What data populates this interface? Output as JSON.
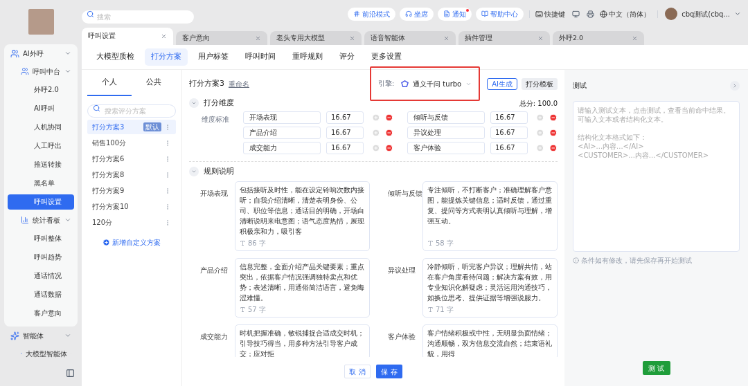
{
  "sidebar": {
    "nav": [
      {
        "label": "AI外呼",
        "expanded": true,
        "children": [
          {
            "label": "呼叫中台",
            "expanded": true,
            "children": [
              {
                "label": "外呼2.0",
                "selected": false
              },
              {
                "label": "AI呼叫",
                "selected": false
              },
              {
                "label": "人机协同",
                "selected": false
              },
              {
                "label": "人工呼出",
                "selected": false
              },
              {
                "label": "推送转接",
                "selected": false
              },
              {
                "label": "黑名单",
                "selected": false
              },
              {
                "label": "呼叫设置",
                "selected": true
              }
            ]
          },
          {
            "label": "统计看板",
            "expanded": true,
            "children": [
              {
                "label": "呼叫整体",
                "selected": false
              },
              {
                "label": "呼叫趋势",
                "selected": false
              },
              {
                "label": "通话情况",
                "selected": false
              },
              {
                "label": "通话数据",
                "selected": false
              },
              {
                "label": "客户意向",
                "selected": false
              }
            ]
          }
        ]
      },
      {
        "label": "智能体",
        "expanded": true,
        "children": [
          {
            "label": "大模型智能体",
            "expanded": false
          }
        ]
      }
    ]
  },
  "topbar": {
    "search": {
      "placeholder": "搜索"
    },
    "buttons": [
      {
        "label": "前沿模式",
        "badge": false
      },
      {
        "label": "坐席",
        "badge": false
      },
      {
        "label": "通知",
        "badge": true
      },
      {
        "label": "帮助中心",
        "badge": false
      }
    ],
    "shortcut": "快捷键",
    "language": "中文（简体）",
    "user": "cbq测试(cbq..."
  },
  "page_tabs": [
    {
      "label": "呼叫设置",
      "selected": true
    },
    {
      "label": "客户意向",
      "selected": false
    },
    {
      "label": "老头专用大模型",
      "selected": false
    },
    {
      "label": "语音智能体",
      "selected": false
    },
    {
      "label": "插件管理",
      "selected": false
    },
    {
      "label": "外呼2.0",
      "selected": false
    }
  ],
  "sub_tabs": [
    {
      "label": "大模型质检",
      "selected": false
    },
    {
      "label": "打分方案",
      "selected": true
    },
    {
      "label": "用户标签",
      "selected": false
    },
    {
      "label": "呼叫时间",
      "selected": false
    },
    {
      "label": "重呼规则",
      "selected": false
    },
    {
      "label": "评分",
      "selected": false
    },
    {
      "label": "更多设置",
      "selected": false
    }
  ],
  "schemes": {
    "tabs": [
      {
        "label": "个人",
        "selected": true
      },
      {
        "label": "公共",
        "selected": false
      }
    ],
    "search": {
      "placeholder": "搜索评分方案"
    },
    "items": [
      {
        "name": "打分方案3",
        "tag": "默认",
        "selected": true
      },
      {
        "name": "销售100分",
        "selected": false
      },
      {
        "name": "打分方案6",
        "selected": false
      },
      {
        "name": "打分方案8",
        "selected": false
      },
      {
        "name": "打分方案9",
        "selected": false
      },
      {
        "name": "打分方案10",
        "selected": false
      },
      {
        "name": "120分",
        "selected": false
      }
    ],
    "add": "新增自定义方案"
  },
  "editor": {
    "title": "打分方案3",
    "rename": "重命名",
    "engine": {
      "label": "引擎:",
      "model": "通义千问 turbo",
      "highlighted": true
    },
    "ai_button": "AI生成",
    "template_button": "打分模板",
    "dimensions_section": {
      "title": "打分维度",
      "expanded": true,
      "total": "总分: 100.0",
      "row_label": "维度标准",
      "items": [
        {
          "name": "开场表现",
          "score": "16.67"
        },
        {
          "name": "倾听与反馈",
          "score": "16.67"
        },
        {
          "name": "产品介绍",
          "score": "16.67"
        },
        {
          "name": "异议处理",
          "score": "16.67"
        },
        {
          "name": "成交能力",
          "score": "16.67"
        },
        {
          "name": "客户体验",
          "score": "16.67"
        }
      ]
    },
    "rules_section": {
      "title": "规则说明",
      "expanded": true,
      "items": [
        {
          "name": "开场表现",
          "text": "包括接听及时性，能在设定铃响次数内接听；自我介绍清晰，清楚表明身份、公司、职位等信息；通话目的明确，开场白清晰说明来电意图；语气态度热情，展现积极亲和力，吸引客",
          "count": "86 字"
        },
        {
          "name": "倾听与反馈",
          "text": "专注倾听，不打断客户；准确理解客户意图，能提炼关键信息；适时反馈，通过重复、提问等方式表明认真倾听与理解，增强互动。",
          "count": "58 字"
        },
        {
          "name": "产品介绍",
          "text": "信息完整，全面介绍产品关键要素；重点突出，依据客户情况强调独特卖点和优势；表述清晰，用通俗简洁语言，避免晦涩难懂。",
          "count": "57 字"
        },
        {
          "name": "异议处理",
          "text": "冷静倾听，听完客户异议；理解共情，站在客户角度看待问题；解决方案有效，用专业知识化解疑虑；灵活运用沟通技巧，如换位思考、提供证据等增强说服力。",
          "count": "71 字"
        },
        {
          "name": "成交能力",
          "text": "时机把握准确，敏锐捕捉合适成交时机；引导技巧得当，用多种方法引导客户成交；应对拒"
        },
        {
          "name": "客户体验",
          "text": "客户情绪积极或中性，无明显负面情绪；沟通顺畅，双方信息交流自然；结束语礼貌，用得"
        }
      ]
    },
    "cancel": "取 消",
    "save": "保 存"
  },
  "test": {
    "title": "测试",
    "placeholder": [
      "请输入测试文本，点击测试，查看当前命中结果。可输入文本或者结构化文本。",
      "结构化文本格式如下：",
      "<AI>...内容...</AI>",
      "<CUSTOMER>...内容...</CUSTOMER>"
    ],
    "note": "条件如有修改，请先保存再开始测试",
    "button": "测 试"
  }
}
